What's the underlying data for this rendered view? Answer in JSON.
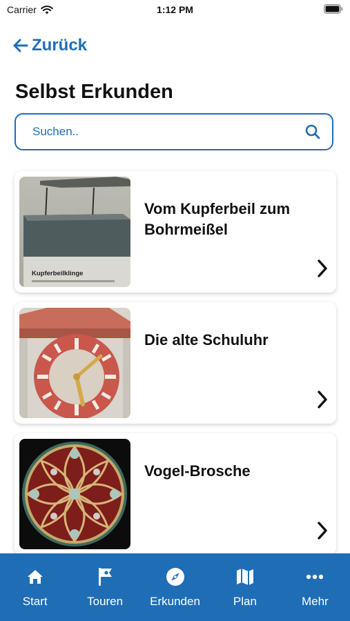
{
  "status_bar": {
    "carrier": "Carrier",
    "time": "1:12 PM"
  },
  "nav": {
    "back_label": "Zurück"
  },
  "page": {
    "title": "Selbst Erkunden"
  },
  "search": {
    "placeholder": "Suchen.."
  },
  "cards": [
    {
      "title": "Vom Kupferbeil zum Bohrmeißel",
      "image_caption": "Kupferbeilklinge"
    },
    {
      "title": "Die alte Schuluhr"
    },
    {
      "title": "Vogel-Brosche"
    }
  ],
  "tab_bar": {
    "items": [
      {
        "label": "Start",
        "icon": "home-icon"
      },
      {
        "label": "Touren",
        "icon": "flag-icon"
      },
      {
        "label": "Erkunden",
        "icon": "compass-icon"
      },
      {
        "label": "Plan",
        "icon": "map-icon"
      },
      {
        "label": "Mehr",
        "icon": "more-icon"
      }
    ]
  },
  "colors": {
    "accent": "#1f6db5",
    "tab_bar_background": "#1f6db5",
    "text": "#111111"
  }
}
